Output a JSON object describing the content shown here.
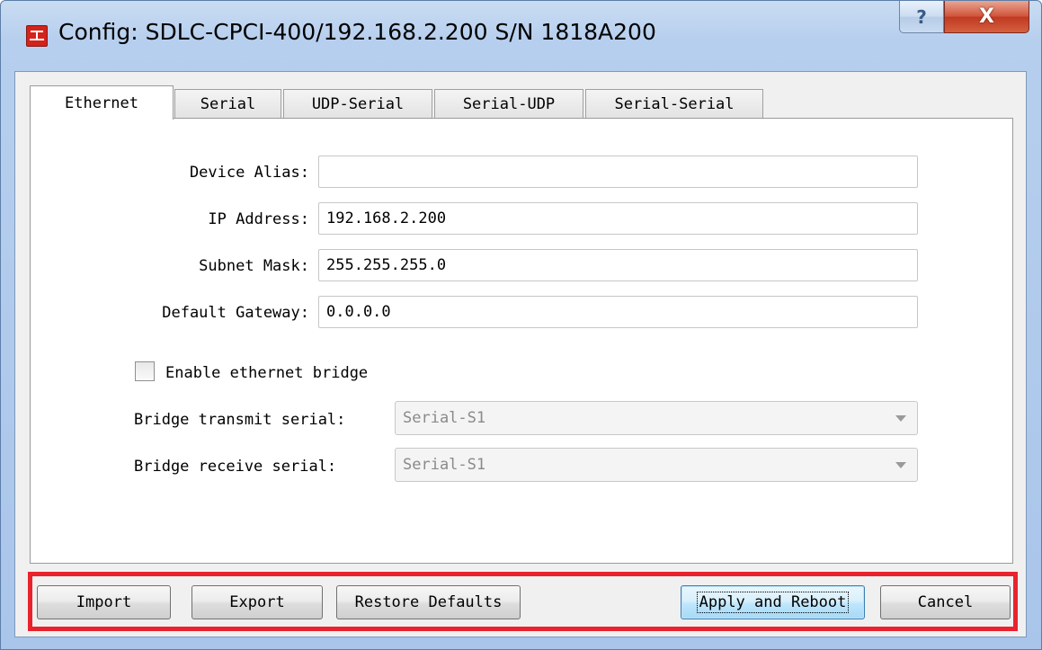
{
  "window": {
    "title": "Config: SDLC-CPCI-400/192.168.2.200  S/N 1818A200",
    "help_label": "?",
    "close_label": "X"
  },
  "tabs": [
    {
      "label": "Ethernet",
      "active": true
    },
    {
      "label": "Serial",
      "active": false
    },
    {
      "label": "UDP-Serial",
      "active": false
    },
    {
      "label": "Serial-UDP",
      "active": false
    },
    {
      "label": "Serial-Serial",
      "active": false
    }
  ],
  "ethernet": {
    "device_alias": {
      "label": "Device Alias:",
      "value": ""
    },
    "ip_address": {
      "label": "IP Address:",
      "value": "192.168.2.200"
    },
    "subnet_mask": {
      "label": "Subnet Mask:",
      "value": "255.255.255.0"
    },
    "default_gateway": {
      "label": "Default Gateway:",
      "value": "0.0.0.0"
    },
    "bridge_enable": {
      "label": "Enable ethernet bridge",
      "checked": false
    },
    "bridge_transmit": {
      "label": "Bridge transmit serial:",
      "value": "Serial-S1",
      "enabled": false
    },
    "bridge_receive": {
      "label": "Bridge receive serial:",
      "value": "Serial-S1",
      "enabled": false
    }
  },
  "buttons": {
    "import": "Import",
    "export": "Export",
    "restore": "Restore Defaults",
    "apply": "Apply and Reboot",
    "cancel": "Cancel"
  },
  "colors": {
    "highlight_border": "#e8232e",
    "close_button": "#c8452c",
    "app_icon": "#d3231b"
  }
}
